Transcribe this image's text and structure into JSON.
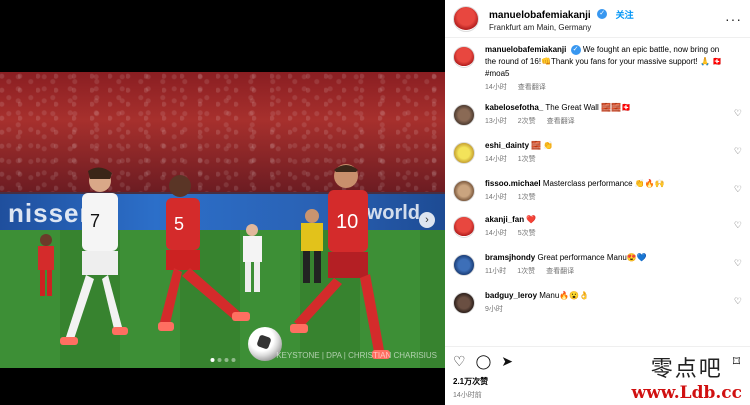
{
  "post": {
    "username": "manuelobafemiakanji",
    "follow_label": "关注",
    "location": "Frankfurt am Main, Germany",
    "caption": "We fought an epic battle, now bring on the round of 16!👊Thank you fans for your massive support! 🙏 🇨🇭#moa5",
    "caption_time": "14小时",
    "translate_label": "查看翻译",
    "likes": "2.1万次赞",
    "time": "14小时前"
  },
  "photo": {
    "ad_text_1": "nissen",
    "ad_text_2": "OO world",
    "credit": "KEYSTONE | DPA | CHRISTIAN CHARISIUS",
    "alt": "Match photo"
  },
  "comments": [
    {
      "user": "kabelosefotha_",
      "text": "The Great Wall 🧱🧱🇨🇭",
      "time": "13小时",
      "likes": "2次赞",
      "translate": "查看翻译"
    },
    {
      "user": "eshi_dainty",
      "text": "🧱 👏",
      "time": "14小时",
      "likes": "1次赞",
      "translate": ""
    },
    {
      "user": "fissoo.michael",
      "text": "Masterclass performance 👏🔥🙌",
      "time": "14小时",
      "likes": "1次赞",
      "translate": ""
    },
    {
      "user": "akanji_fan",
      "text": "❤️",
      "time": "14小时",
      "likes": "5次赞",
      "translate": ""
    },
    {
      "user": "bramsjhondy",
      "text": "Great performance Manu😍💙",
      "time": "11小时",
      "likes": "1次赞",
      "translate": "查看翻译"
    },
    {
      "user": "badguy_leroy",
      "text": "Manu🔥😮👌",
      "time": "9小时",
      "likes": "",
      "translate": ""
    }
  ],
  "watermark": {
    "line1": "零点吧",
    "line2": "www.Ldb.cc"
  },
  "icons": {
    "like": "heart-icon",
    "comment": "comment-icon",
    "share": "share-icon",
    "save": "bookmark-icon",
    "more": "more-icon"
  },
  "colors": {
    "accent": "#0095f6",
    "verified": "#3897f0",
    "watermark_red": "#d01010"
  }
}
